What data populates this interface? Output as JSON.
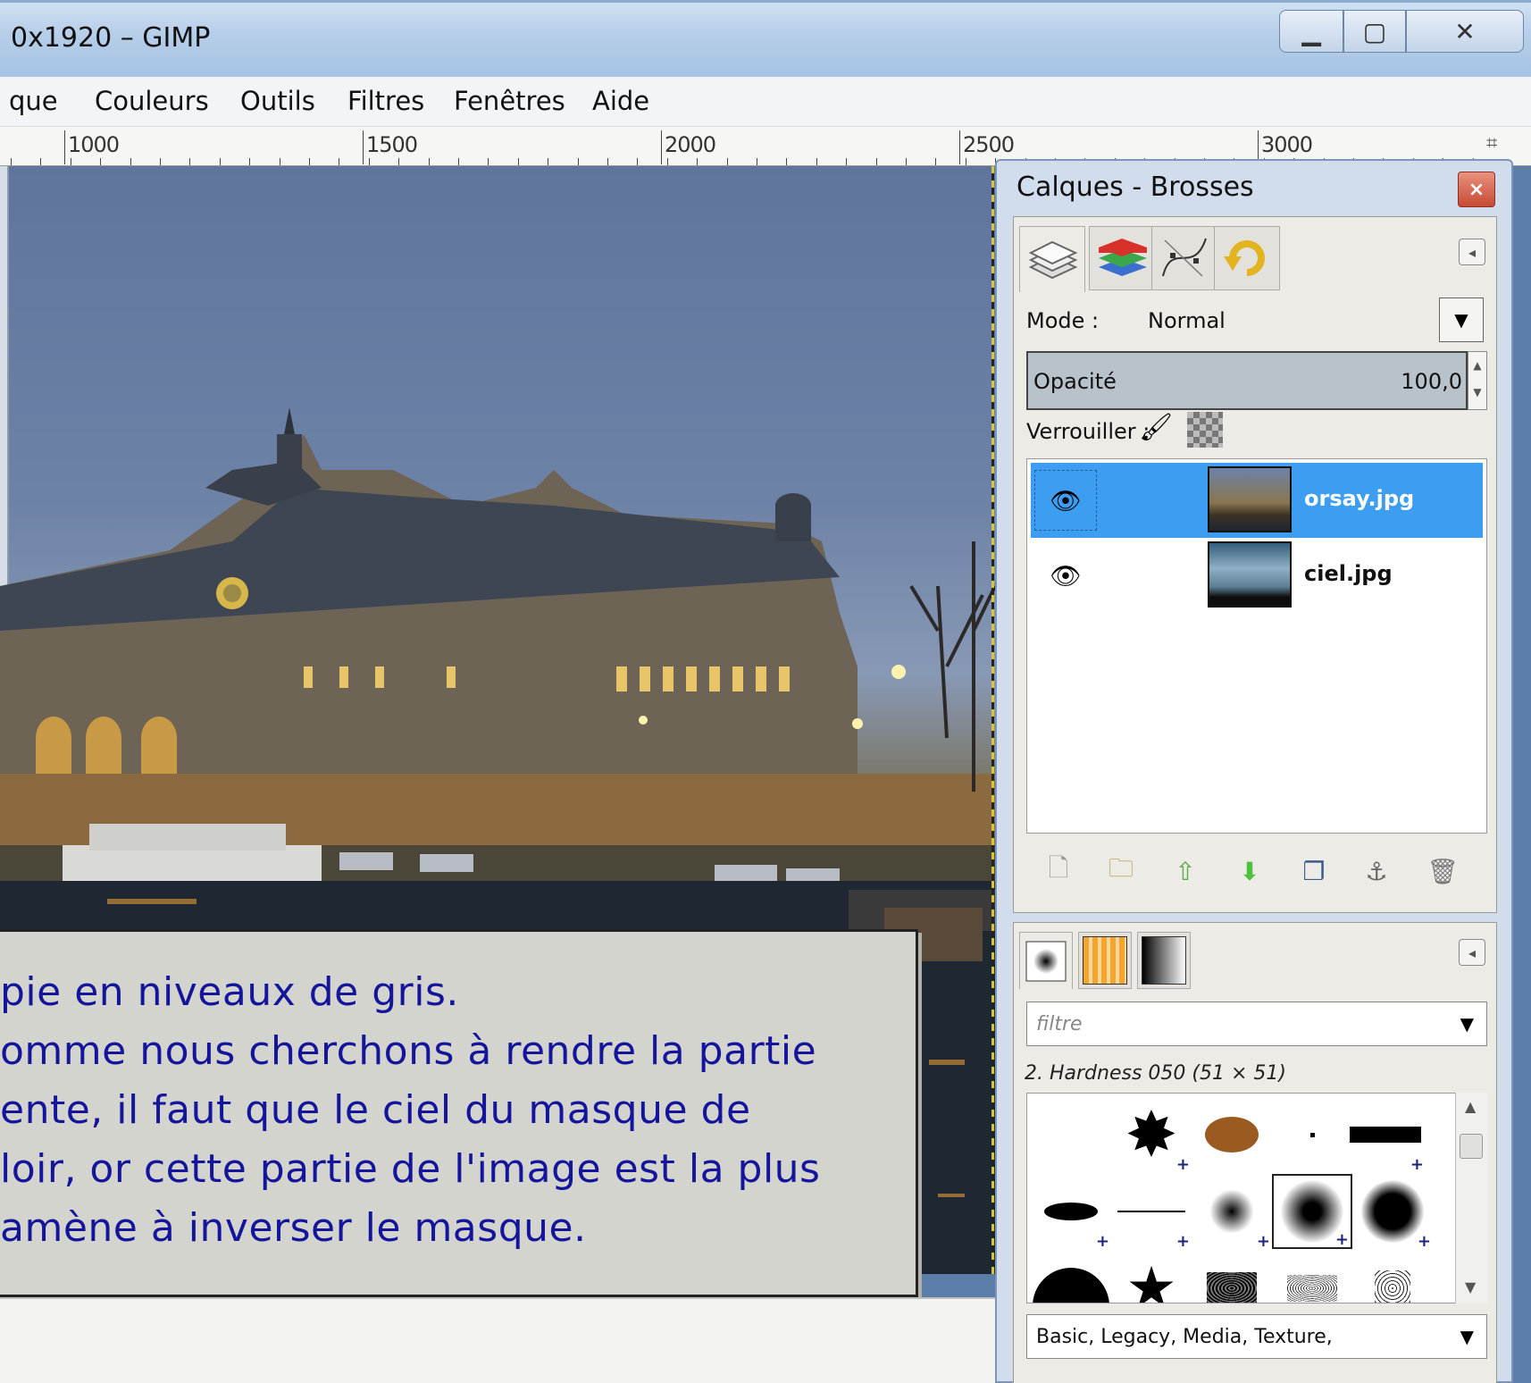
{
  "window": {
    "title": "0x1920 – GIMP",
    "minimize_glyph": "▁",
    "maximize_glyph": "▢",
    "close_glyph": "✕"
  },
  "menu": [
    "que",
    "Couleurs",
    "Outils",
    "Filtres",
    "Fenêtres",
    "Aide"
  ],
  "ruler": {
    "labels": [
      "1000",
      "1500",
      "2000",
      "2500",
      "3000"
    ]
  },
  "caption": {
    "lines": [
      "pie en niveaux de gris.",
      "omme nous cherchons à rendre la partie",
      "ente, il faut que le ciel du masque de",
      "loir, or cette partie de l'image est la plus",
      " amène à inverser le masque."
    ]
  },
  "dock": {
    "title": "Calques - Brosses",
    "close_glyph": "×",
    "layers_tab_icons": [
      "layers-icon",
      "channels-icon",
      "paths-icon",
      "undo-history-icon"
    ],
    "mode_label": "Mode :",
    "mode_value": "Normal",
    "opacity_label": "Opacité",
    "opacity_value": "100,0",
    "lock_label": "Verrouiller :",
    "layers": [
      {
        "name": "orsay.jpg",
        "visible": true,
        "selected": true
      },
      {
        "name": "ciel.jpg",
        "visible": true,
        "selected": false
      }
    ],
    "layer_actions": [
      "new-layer-icon",
      "new-group-icon",
      "raise-layer-icon",
      "lower-layer-icon",
      "duplicate-layer-icon",
      "anchor-layer-icon",
      "delete-layer-icon"
    ],
    "brushes_tab_icons": [
      "brushes-icon",
      "patterns-icon",
      "gradients-icon"
    ],
    "filter_placeholder": "filtre",
    "brush_name": "2. Hardness 050 (51 × 51)",
    "tags": "Basic, Legacy, Media, Texture,"
  },
  "colors": {
    "accent_selected": "#3d9df0",
    "caption_text": "#15159c",
    "titlebar": "#b5cde8"
  }
}
